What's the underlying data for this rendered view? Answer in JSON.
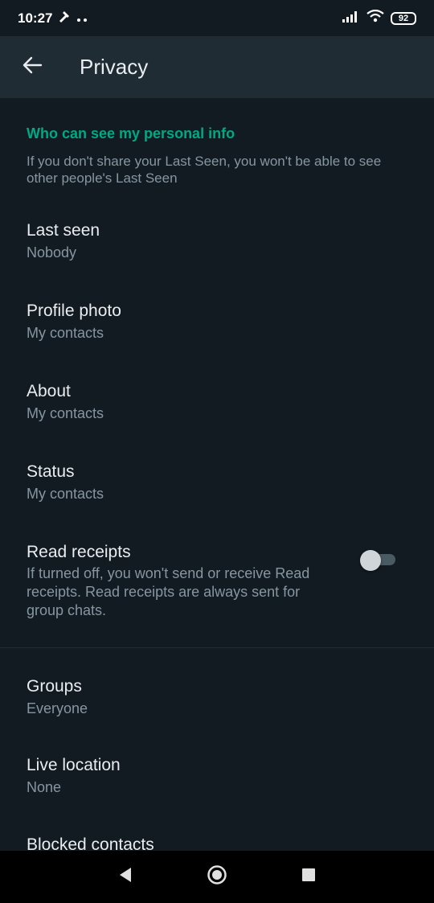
{
  "status_bar": {
    "time": "10:27",
    "battery": "92"
  },
  "app_bar": {
    "title": "Privacy"
  },
  "section": {
    "header": "Who can see my personal info",
    "description": "If you don't share your Last Seen, you won't be able to see other people's Last Seen"
  },
  "settings": {
    "last_seen": {
      "title": "Last seen",
      "value": "Nobody"
    },
    "profile_photo": {
      "title": "Profile photo",
      "value": "My contacts"
    },
    "about": {
      "title": "About",
      "value": "My contacts"
    },
    "status": {
      "title": "Status",
      "value": "My contacts"
    },
    "read_receipts": {
      "title": "Read receipts",
      "description": "If turned off, you won't send or receive Read receipts. Read receipts are always sent for group chats.",
      "enabled": false
    },
    "groups": {
      "title": "Groups",
      "value": "Everyone"
    },
    "live_location": {
      "title": "Live location",
      "value": "None"
    },
    "blocked_contacts": {
      "title": "Blocked contacts"
    }
  },
  "colors": {
    "background": "#121b22",
    "app_bar": "#1f2c34",
    "accent": "#00a884",
    "secondary_text": "#8696a0"
  },
  "icons": {
    "back": "arrow-left-icon",
    "nav_back": "triangle-back-icon",
    "nav_home": "circle-home-icon",
    "nav_recents": "square-recents-icon"
  }
}
